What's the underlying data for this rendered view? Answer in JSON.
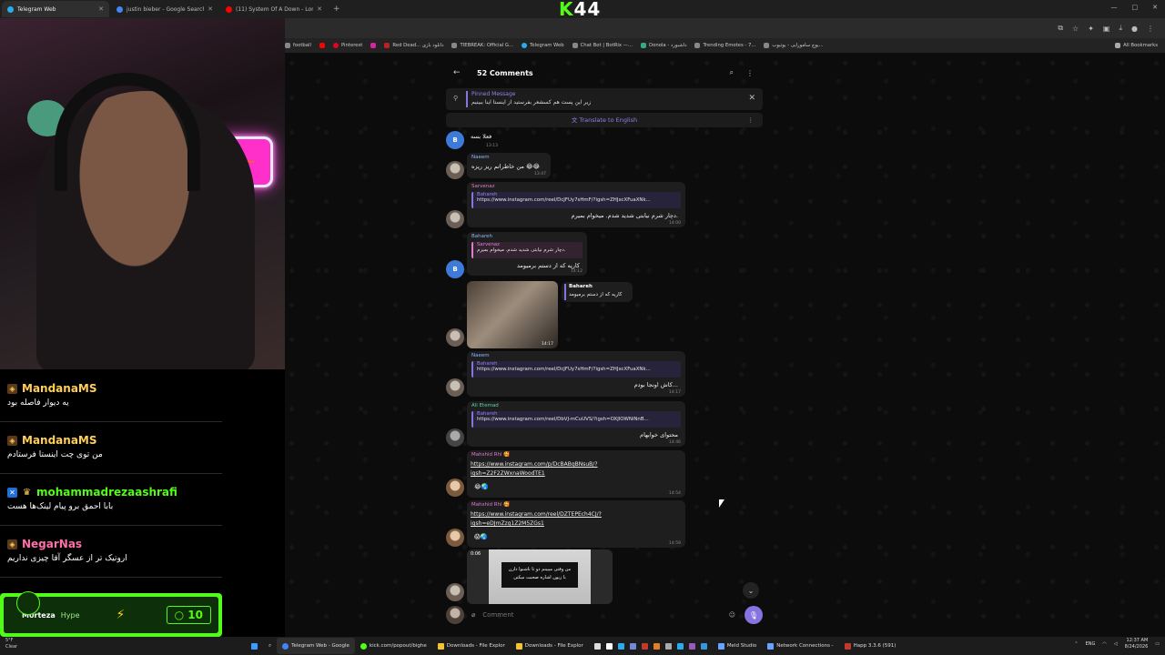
{
  "browser": {
    "tabs": [
      {
        "title": "Telegram Web",
        "color": "#2aabee",
        "active": true
      },
      {
        "title": "justin bieber - Google Search",
        "color": "#4285f4",
        "active": false
      },
      {
        "title": "(11) System Of A Down - Lonel",
        "color": "#ff0000",
        "active": false
      }
    ],
    "new_tab": "+",
    "window_controls": [
      "—",
      "□",
      "✕"
    ],
    "bookmarks": [
      {
        "label": "football",
        "color": "#888"
      },
      {
        "label": "",
        "color": "#ff0000"
      },
      {
        "label": "Pinterest",
        "color": "#e60023"
      },
      {
        "label": "",
        "color": "#d6249f"
      },
      {
        "label": "Red Dead... دانلود بازی",
        "color": "#b22"
      },
      {
        "label": "TIEBREAK: Official G...",
        "color": "#888"
      },
      {
        "label": "Telegram Web",
        "color": "#2aabee"
      },
      {
        "label": "Chat Bot | BotRix —...",
        "color": "#888"
      },
      {
        "label": "Donola - داشبورد",
        "color": "#3a8"
      },
      {
        "label": "Trending Emotes - 7...",
        "color": "#888"
      },
      {
        "label": "یوچ سامورایی - یوتیوب...",
        "color": "#888"
      }
    ],
    "all_bookmarks": "All Bookmarks"
  },
  "overlay_logo": {
    "k": "K",
    "num": "44"
  },
  "telegram": {
    "header_title": "52 Comments",
    "pinned": {
      "label": "Pinned Message",
      "text": "زیر این پست هم کسشعر بفرستید از اینستا اینا ببینیم"
    },
    "translate": "Translate to English",
    "composer_placeholder": "Comment",
    "messages": [
      {
        "text": "فعلا بسه",
        "time": "13:13"
      },
      {
        "sender": "Naeem",
        "text": "من خاطراتم ریز ریزه 😂😂",
        "time": "13:47"
      },
      {
        "sender": "Sarvenaz",
        "quote_author": "Bahareh",
        "quote": "https://www.instagram.com/reel/DcJFUy7sHmF/?igsh=ZHJxcXFuaXNk...",
        "text": "دچار شرم نیابتی شدید شدم. میخوام بمیرم.",
        "time": "14:00"
      },
      {
        "sender": "Bahareh",
        "quote_author": "Sarvenaz",
        "quote": "دچار شرم نیابتی شدید شدم. میخوام بمیرم.",
        "text": "کاریه که از دستم برمیومد",
        "time": "14:12"
      },
      {
        "reply_author": "Bahareh",
        "reply_text": "کاریه که از دستم برمیومد",
        "time": "14:17"
      },
      {
        "sender": "Naeem",
        "quote_author": "Bahareh",
        "quote": "https://www.instagram.com/reel/DcJFUy7sHmF/?igsh=ZHJxcXFuaXNk...",
        "text": "کاش اونجا بودم...",
        "time": "14:17"
      },
      {
        "sender": "Ali Etemad",
        "quote_author": "Bahareh",
        "quote": "https://www.instagram.com/reel/DbVJ-mCuUVS/?igsh=OXJlOWNiNnB...",
        "text": "محتوای خوابهام",
        "time": "14:46"
      },
      {
        "sender": "Mahshid Rhl 🥰",
        "link1": "https://www.instagram.com/p/DcBABqBNsuB/?",
        "link2": "igsh=Z2F2ZWxnaWoodTE1",
        "emoji": "😂🌏",
        "time": "14:54"
      },
      {
        "sender": "Mahshid Rhl 🥰",
        "link1": "https://www.instagram.com/reel/DZTEPEch4CJ/?",
        "link2": "igsh=eDJmZzg1Z2M5ZGs1",
        "emoji": "😱🌏",
        "time": "14:59"
      },
      {
        "video_duration": "0:06",
        "video_caption1": "من وقتی میبینم دو تا ناشنوا دارن",
        "video_caption2": "با زبون اشاره صحبت میکنن"
      }
    ]
  },
  "chat": {
    "messages": [
      {
        "user": "MandanaMS",
        "color": "#ffcf56",
        "text": "یه دیوار فاصله بود"
      },
      {
        "user": "MandanaMS",
        "color": "#ffcf56",
        "text": "من توی چت اینستا فرستادم"
      },
      {
        "user": "mohammadrezaashrafi",
        "color": "#53fc18",
        "text": "بابا احمق برو پیام لینک‌ها هست"
      },
      {
        "user": "NegarNas",
        "color": "#ff6fa8",
        "text": "اروتیک تر از عسگر آقا چیزی نداریم"
      }
    ],
    "hype": {
      "user": "M0rteza",
      "label": "Hype",
      "count": "10"
    }
  },
  "taskbar": {
    "weather_temp": "5°F",
    "weather_desc": "Clear",
    "items": [
      {
        "label": "Telegram Web - Google",
        "color": "#4285f4"
      },
      {
        "label": "kick.com/popout/bighe",
        "color": "#53fc18"
      },
      {
        "label": "Downloads - File Explor",
        "color": "#f4c430"
      },
      {
        "label": "Downloads - File Explor",
        "color": "#f4c430"
      },
      {
        "label": "Meld Studio",
        "color": "#6aa3ff"
      },
      {
        "label": "Network Connections -",
        "color": "#6aa3ff"
      },
      {
        "label": "Happ 3.3.6 (591)",
        "color": "#c0392b"
      }
    ],
    "lang": "ENG",
    "time": "12:37 AM",
    "date": "8/24/2026"
  }
}
